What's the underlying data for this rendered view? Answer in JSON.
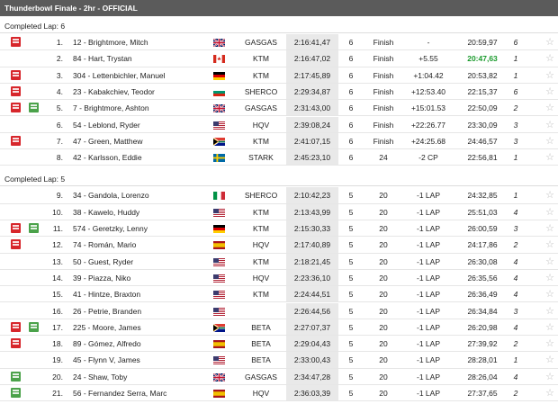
{
  "title": "Thunderbowl Finale - 2hr - OFFICIAL",
  "colors": {
    "red_tag": "#d7262b",
    "green_tag": "#4ba24a",
    "best_green": "#1a9a2c"
  },
  "groups": [
    {
      "label": "Completed Lap: 6",
      "rows": [
        {
          "tags": [
            "red"
          ],
          "pos": "1.",
          "rider": "12 - Brightmore, Mitch",
          "flag": "gb",
          "brand": "GASGAS",
          "time": "2:16:41,47",
          "laps": "6",
          "status": "Finish",
          "gap": "-",
          "best": "20:59,97",
          "bestGreen": false,
          "fl": "6"
        },
        {
          "tags": [],
          "pos": "2.",
          "rider": "84 - Hart, Trystan",
          "flag": "ca",
          "brand": "KTM",
          "time": "2:16:47,02",
          "laps": "6",
          "status": "Finish",
          "gap": "+5.55",
          "best": "20:47,63",
          "bestGreen": true,
          "fl": "1"
        },
        {
          "tags": [
            "red"
          ],
          "pos": "3.",
          "rider": "304 - Lettenbichler, Manuel",
          "flag": "de",
          "brand": "KTM",
          "time": "2:17:45,89",
          "laps": "6",
          "status": "Finish",
          "gap": "+1:04.42",
          "best": "20:53,82",
          "bestGreen": false,
          "fl": "1"
        },
        {
          "tags": [
            "red"
          ],
          "pos": "4.",
          "rider": "23 - Kabakchiev, Teodor",
          "flag": "bg",
          "brand": "SHERCO",
          "time": "2:29:34,87",
          "laps": "6",
          "status": "Finish",
          "gap": "+12:53.40",
          "best": "22:15,37",
          "bestGreen": false,
          "fl": "6"
        },
        {
          "tags": [
            "red",
            "green"
          ],
          "pos": "5.",
          "rider": "7 - Brightmore, Ashton",
          "flag": "gb",
          "brand": "GASGAS",
          "time": "2:31:43,00",
          "laps": "6",
          "status": "Finish",
          "gap": "+15:01.53",
          "best": "22:50,09",
          "bestGreen": false,
          "fl": "2"
        },
        {
          "tags": [],
          "pos": "6.",
          "rider": "54 - Leblond, Ryder",
          "flag": "us",
          "brand": "HQV",
          "time": "2:39:08,24",
          "laps": "6",
          "status": "Finish",
          "gap": "+22:26.77",
          "best": "23:30,09",
          "bestGreen": false,
          "fl": "3"
        },
        {
          "tags": [
            "red"
          ],
          "pos": "7.",
          "rider": "47 - Green, Matthew",
          "flag": "za",
          "brand": "KTM",
          "time": "2:41:07,15",
          "laps": "6",
          "status": "Finish",
          "gap": "+24:25.68",
          "best": "24:46,57",
          "bestGreen": false,
          "fl": "3"
        },
        {
          "tags": [],
          "pos": "8.",
          "rider": "42 - Karlsson, Eddie",
          "flag": "se",
          "brand": "STARK",
          "time": "2:45:23,10",
          "laps": "6",
          "status": "24",
          "gap": "-2 CP",
          "best": "22:56,81",
          "bestGreen": false,
          "fl": "1"
        }
      ]
    },
    {
      "label": "Completed Lap: 5",
      "rows": [
        {
          "tags": [],
          "pos": "9.",
          "rider": "34 - Gandola, Lorenzo",
          "flag": "it",
          "brand": "SHERCO",
          "time": "2:10:42,23",
          "laps": "5",
          "status": "20",
          "gap": "-1 LAP",
          "best": "24:32,85",
          "bestGreen": false,
          "fl": "1"
        },
        {
          "tags": [],
          "pos": "10.",
          "rider": "38 - Kawelo, Huddy",
          "flag": "us",
          "brand": "KTM",
          "time": "2:13:43,99",
          "laps": "5",
          "status": "20",
          "gap": "-1 LAP",
          "best": "25:51,03",
          "bestGreen": false,
          "fl": "4"
        },
        {
          "tags": [
            "red",
            "green"
          ],
          "pos": "11.",
          "rider": "574 - Geretzky, Lenny",
          "flag": "de",
          "brand": "KTM",
          "time": "2:15:30,33",
          "laps": "5",
          "status": "20",
          "gap": "-1 LAP",
          "best": "26:00,59",
          "bestGreen": false,
          "fl": "3"
        },
        {
          "tags": [
            "red"
          ],
          "pos": "12.",
          "rider": "74 - Román, Mario",
          "flag": "es",
          "brand": "HQV",
          "time": "2:17:40,89",
          "laps": "5",
          "status": "20",
          "gap": "-1 LAP",
          "best": "24:17,86",
          "bestGreen": false,
          "fl": "2"
        },
        {
          "tags": [],
          "pos": "13.",
          "rider": "50 - Guest, Ryder",
          "flag": "us",
          "brand": "KTM",
          "time": "2:18:21,45",
          "laps": "5",
          "status": "20",
          "gap": "-1 LAP",
          "best": "26:30,08",
          "bestGreen": false,
          "fl": "4"
        },
        {
          "tags": [],
          "pos": "14.",
          "rider": "39 - Piazza, Niko",
          "flag": "us",
          "brand": "HQV",
          "time": "2:23:36,10",
          "laps": "5",
          "status": "20",
          "gap": "-1 LAP",
          "best": "26:35,56",
          "bestGreen": false,
          "fl": "4"
        },
        {
          "tags": [],
          "pos": "15.",
          "rider": "41 - Hintze, Braxton",
          "flag": "us",
          "brand": "KTM",
          "time": "2:24:44,51",
          "laps": "5",
          "status": "20",
          "gap": "-1 LAP",
          "best": "26:36,49",
          "bestGreen": false,
          "fl": "4"
        },
        {
          "tags": [],
          "pos": "16.",
          "rider": "26 - Petrie, Branden",
          "flag": "us",
          "brand": "",
          "time": "2:26:44,56",
          "laps": "5",
          "status": "20",
          "gap": "-1 LAP",
          "best": "26:34,84",
          "bestGreen": false,
          "fl": "3"
        },
        {
          "tags": [
            "red",
            "green"
          ],
          "pos": "17.",
          "rider": "225 - Moore, James",
          "flag": "za",
          "brand": "BETA",
          "time": "2:27:07,37",
          "laps": "5",
          "status": "20",
          "gap": "-1 LAP",
          "best": "26:20,98",
          "bestGreen": false,
          "fl": "4"
        },
        {
          "tags": [
            "red"
          ],
          "pos": "18.",
          "rider": "89 - Gómez, Alfredo",
          "flag": "es",
          "brand": "BETA",
          "time": "2:29:04,43",
          "laps": "5",
          "status": "20",
          "gap": "-1 LAP",
          "best": "27:39,92",
          "bestGreen": false,
          "fl": "2"
        },
        {
          "tags": [],
          "pos": "19.",
          "rider": "45 - Flynn V, James",
          "flag": "us",
          "brand": "BETA",
          "time": "2:33:00,43",
          "laps": "5",
          "status": "20",
          "gap": "-1 LAP",
          "best": "28:28,01",
          "bestGreen": false,
          "fl": "1"
        },
        {
          "tags": [
            "green"
          ],
          "pos": "20.",
          "rider": "24 - Shaw, Toby",
          "flag": "gb",
          "brand": "GASGAS",
          "time": "2:34:47,28",
          "laps": "5",
          "status": "20",
          "gap": "-1 LAP",
          "best": "28:26,04",
          "bestGreen": false,
          "fl": "4"
        },
        {
          "tags": [
            "green"
          ],
          "pos": "21.",
          "rider": "56 - Fernandez Serra, Marc",
          "flag": "es",
          "brand": "HQV",
          "time": "2:36:03,39",
          "laps": "5",
          "status": "20",
          "gap": "-1 LAP",
          "best": "27:37,65",
          "bestGreen": false,
          "fl": "2"
        }
      ]
    }
  ]
}
